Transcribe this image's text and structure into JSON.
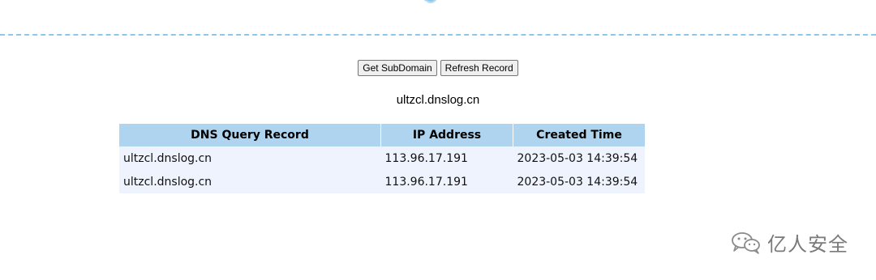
{
  "toolbar": {
    "get_subdomain_label": "Get SubDomain",
    "refresh_record_label": "Refresh Record"
  },
  "subdomain": "ultzcl.dnslog.cn",
  "table": {
    "headers": [
      "DNS Query Record",
      "IP Address",
      "Created Time"
    ],
    "rows": [
      [
        "ultzcl.dnslog.cn",
        "113.96.17.191",
        "2023-05-03 14:39:54"
      ],
      [
        "ultzcl.dnslog.cn",
        "113.96.17.191",
        "2023-05-03 14:39:54"
      ]
    ]
  },
  "watermark": {
    "text": "亿人安全",
    "icon": "wechat-icon"
  },
  "colors": {
    "header_bg": "#aed4ef",
    "row_bg": "#eef3fd",
    "dash_line": "#8cc8ec"
  }
}
